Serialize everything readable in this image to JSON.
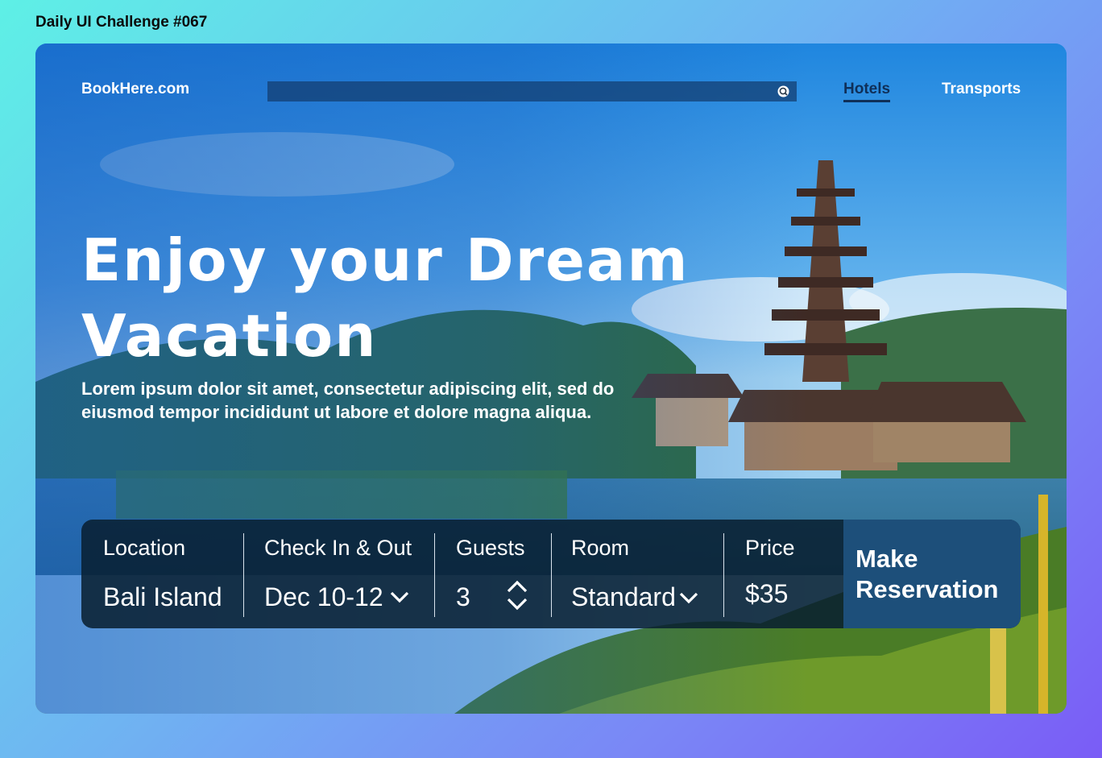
{
  "page": {
    "challenge_title": "Daily UI Challenge #067"
  },
  "header": {
    "brand": "BookHere.com",
    "search": {
      "value": "",
      "placeholder": ""
    },
    "nav": [
      {
        "label": "Hotels",
        "active": true
      },
      {
        "label": "Transports",
        "active": false
      }
    ]
  },
  "hero": {
    "headline_line1": "Enjoy your Dream",
    "headline_line2": "Vacation",
    "subtext": "Lorem ipsum dolor sit amet, consectetur adipiscing elit, sed do eiusmod tempor incididunt ut labore et dolore magna aliqua."
  },
  "booking": {
    "location": {
      "label": "Location",
      "value": "Bali Island"
    },
    "checkin": {
      "label": "Check In & Out",
      "value": "Dec 10-12"
    },
    "guests": {
      "label": "Guests",
      "value": "3"
    },
    "room": {
      "label": "Room",
      "value": "Standard"
    },
    "price": {
      "label": "Price",
      "value": "$35"
    },
    "cta": {
      "line1": "Make",
      "line2": "Reservation"
    }
  },
  "colors": {
    "accent_nav": "#0f2f58",
    "booking_bar": "#081e30",
    "reserve_button": "#1d4f7a"
  },
  "icons": {
    "search": "search-icon",
    "chevron": "chevron-down-icon",
    "stepper": "up-down-stepper-icon"
  }
}
